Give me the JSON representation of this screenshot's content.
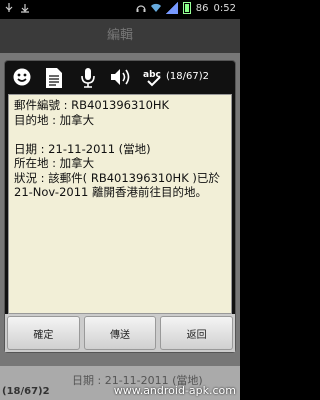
{
  "status_bar": {
    "battery": "86",
    "time": "0:52"
  },
  "background": {
    "title": "編輯",
    "counter": "(18/67)2",
    "partial_date_line": "日期 : 21-11-2011 (當地)",
    "watermark": "www.android-apk.com"
  },
  "dialog": {
    "toolbar": {
      "counter": "(18/67)2"
    },
    "message": [
      "郵件編號 : RB401396310HK",
      "目的地 : 加拿大",
      "",
      "日期 : 21-11-2011 (當地)",
      "所在地 : 加拿大",
      "狀況 : 該郵件( RB401396310HK )已於",
      "21-Nov-2011 離開香港前往目的地。"
    ],
    "buttons": {
      "confirm": "確定",
      "send": "傳送",
      "back": "返回"
    }
  },
  "colors": {
    "text_area_bg": "#f2efd7",
    "dialog_bg": "#111111"
  }
}
